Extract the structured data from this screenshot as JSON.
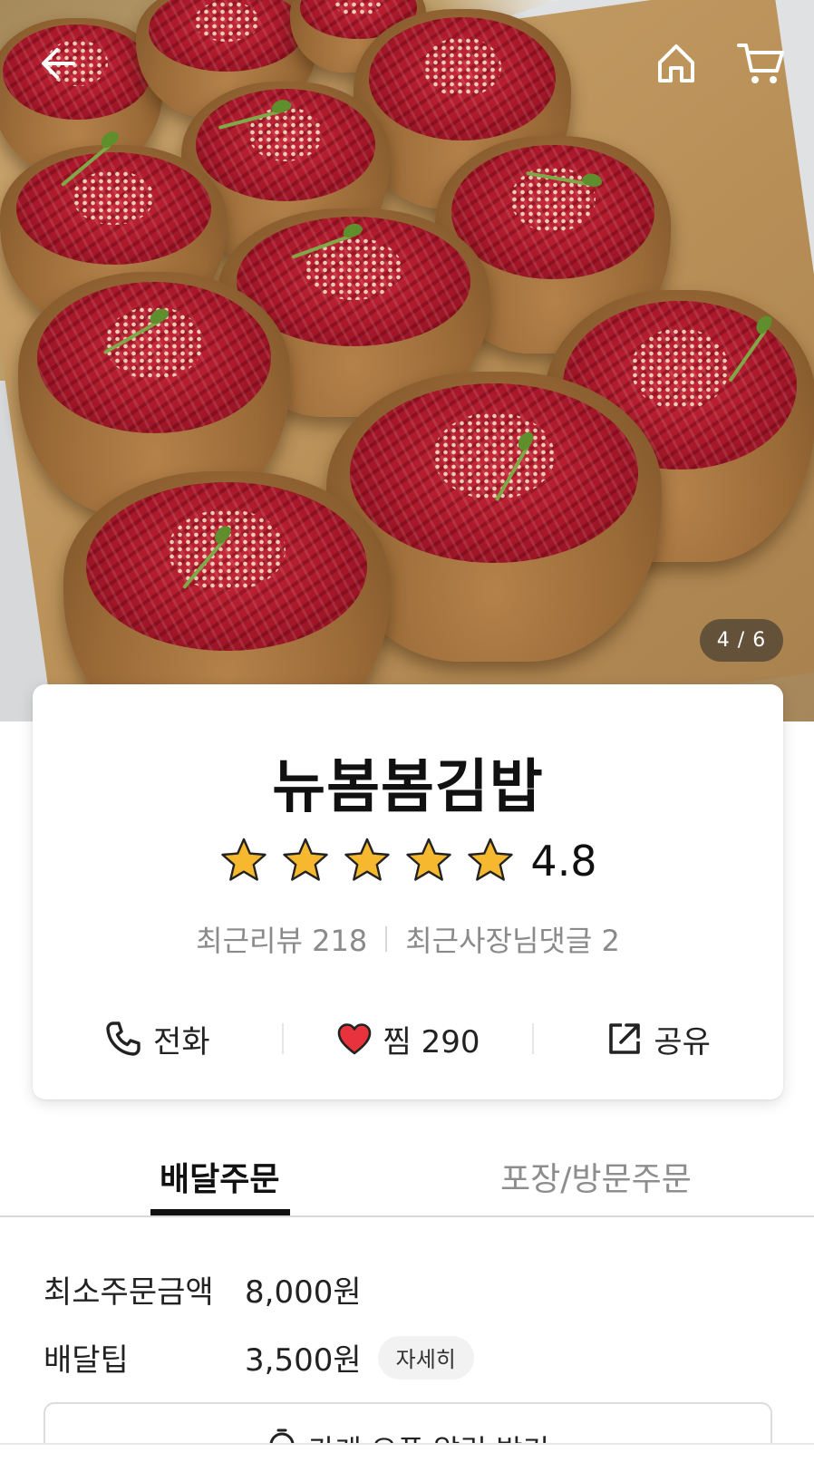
{
  "hero": {
    "photo_subject": "yukhoe-inari-sushi-icon",
    "image_counter": "4 / 6"
  },
  "nav": {
    "back_icon": "arrow-left-icon",
    "home_icon": "home-icon",
    "cart_icon": "cart-icon"
  },
  "store": {
    "name": "뉴봄봄김밥",
    "rating": "4.8",
    "rating_stars": 5,
    "reviews_text": "최근리뷰 218",
    "owner_replies_text": "최근사장님댓글 2"
  },
  "actions": {
    "call_label": "전화",
    "like_label": "찜 290",
    "share_label": "공유"
  },
  "tabs": [
    {
      "label": "배달주문",
      "active": true
    },
    {
      "label": "포장/방문주문",
      "active": false
    }
  ],
  "order_info": {
    "min_order_label": "최소주문금액",
    "min_order_value": "8,000원",
    "delivery_tip_label": "배달팁",
    "delivery_tip_value": "3,500원",
    "detail_label": "자세히"
  },
  "open_alert": {
    "label": "가게 오픈 알림 받기"
  },
  "colors": {
    "star": "#F5B82E",
    "heart": "#E8323C",
    "text_primary": "#111111",
    "text_muted": "#8A8A8A"
  }
}
